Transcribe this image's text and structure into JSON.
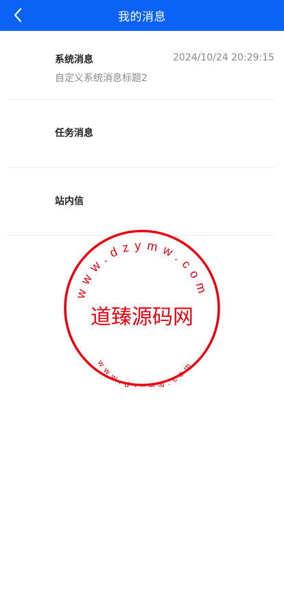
{
  "header": {
    "title": "我的消息",
    "back_icon": "chevron-left-icon"
  },
  "messages": [
    {
      "title": "系统消息",
      "time": "2024/10/24 20:29:15",
      "subtitle": "自定义系统消息标题2"
    },
    {
      "title": "任务消息"
    },
    {
      "title": "站内信"
    }
  ],
  "watermark": {
    "text": "道臻源码网",
    "outer_text": "www.dzymw.com",
    "inner_text": "www.dzymw.com",
    "color": "#e60012"
  }
}
